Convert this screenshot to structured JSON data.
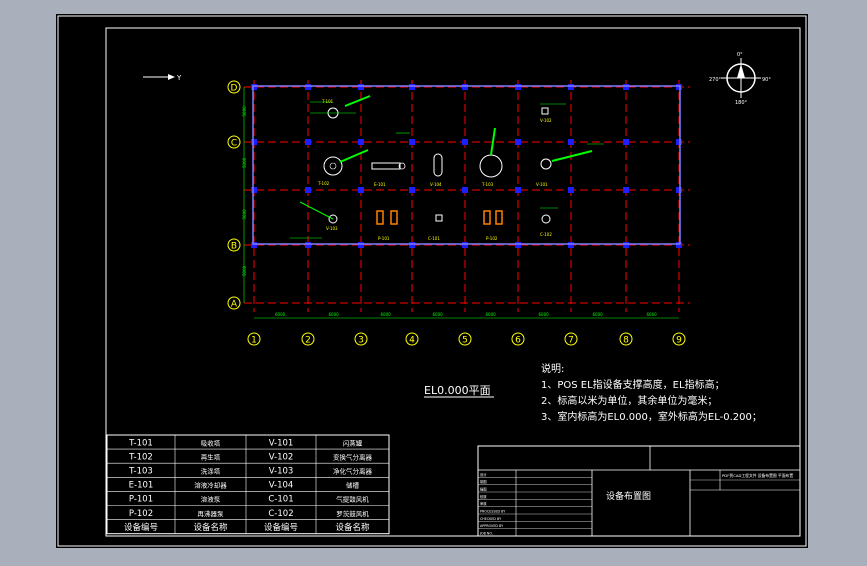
{
  "colors": {
    "background": "#a9b0bc",
    "canvas": "#000000",
    "frame": "#ffffff",
    "grid": "#ff0000",
    "column": "#1e1eff",
    "dims": "#00ff00",
    "labels": "#ffff00",
    "equipment": "#ffffff",
    "orange_equipment": "#ff8000"
  },
  "axis_indicator": {
    "label": "Y"
  },
  "compass": {
    "north": "0°",
    "west": "270°",
    "east": "90°",
    "south": "180°"
  },
  "grid": {
    "rows": [
      "D",
      "C",
      "B",
      "A"
    ],
    "columns": [
      "1",
      "2",
      "3",
      "4",
      "5",
      "6",
      "7",
      "8",
      "9"
    ],
    "spacing_label": "6000",
    "row_spacing_label": "5000"
  },
  "plan_title": "EL0.000平面",
  "notes": {
    "heading": "说明:",
    "items": [
      "1、POS EL指设备支撑高度，EL指标高；",
      "2、标高以米为单位，其余单位为毫米；",
      "3、室内标高为EL0.000，室外标高为EL-0.200；"
    ]
  },
  "equipment_table": {
    "rows": [
      [
        "T-101",
        "吸收塔",
        "V-101",
        "闪蒸罐"
      ],
      [
        "T-102",
        "再生塔",
        "V-102",
        "变换气分离器"
      ],
      [
        "T-103",
        "洗涤塔",
        "V-103",
        "净化气分离器"
      ],
      [
        "E-101",
        "溶液冷却器",
        "V-104",
        "储槽"
      ],
      [
        "P-101",
        "溶液泵",
        "C-101",
        "气提鼓风机"
      ],
      [
        "P-102",
        "再沸器泵",
        "C-102",
        "罗茨鼓风机"
      ]
    ],
    "header": [
      "设备编号",
      "设备名称",
      "设备编号",
      "设备名称"
    ]
  },
  "title_block": {
    "drawing_name": "设备布置图",
    "left_labels": [
      "设计",
      "制图",
      "描图",
      "校核",
      "审核",
      "PROCESSED BY",
      "CHECKED BY",
      "APPROVED BY",
      "JOB NO."
    ],
    "right_top": "PDF到CAD工程文件 设备布置图 平面布置"
  },
  "plan_labels": {
    "T101": "T-101",
    "T102": "T-102",
    "T103": "T-103",
    "E101": "E-101",
    "V101": "V-101",
    "V102": "V-102",
    "V103": "V-103",
    "V104": "V-104",
    "P101": "P-101",
    "P102": "P-102",
    "C101": "C-101",
    "C102": "C-102"
  }
}
